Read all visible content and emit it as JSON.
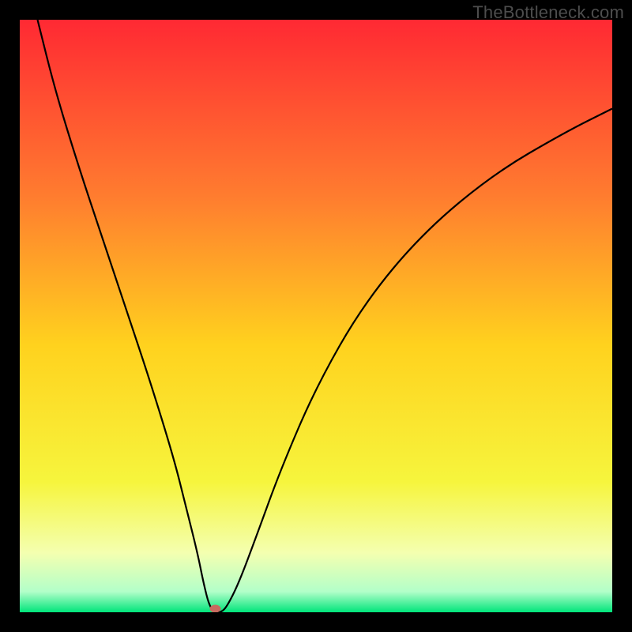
{
  "watermark": "TheBottleneck.com",
  "chart_data": {
    "type": "line",
    "title": "",
    "xlabel": "",
    "ylabel": "",
    "xlim": [
      0,
      100
    ],
    "ylim": [
      0,
      100
    ],
    "grid": false,
    "legend": false,
    "background_gradient_stops": [
      {
        "offset": 0.0,
        "color": "#ff2933"
      },
      {
        "offset": 0.3,
        "color": "#ff7d2f"
      },
      {
        "offset": 0.55,
        "color": "#ffd21e"
      },
      {
        "offset": 0.78,
        "color": "#f6f53d"
      },
      {
        "offset": 0.9,
        "color": "#f4ffb0"
      },
      {
        "offset": 0.965,
        "color": "#b3ffc9"
      },
      {
        "offset": 1.0,
        "color": "#00e57a"
      }
    ],
    "series": [
      {
        "name": "bottleneck-curve",
        "color": "#000000",
        "stroke_width": 2.2,
        "x": [
          3,
          6,
          10,
          14,
          18,
          22,
          26,
          28,
          30,
          31,
          32,
          33,
          34,
          35,
          37,
          40,
          44,
          50,
          58,
          68,
          80,
          92,
          100
        ],
        "y": [
          100,
          88,
          75,
          63,
          51,
          39,
          26,
          18,
          10,
          5,
          1,
          0,
          0,
          1,
          5,
          13,
          24,
          38,
          52,
          64,
          74,
          81,
          85
        ]
      }
    ],
    "marker": {
      "name": "optimal-point",
      "x": 33,
      "y": 0.6,
      "rx": 7,
      "ry": 5,
      "fill": "#c86a5f"
    }
  }
}
